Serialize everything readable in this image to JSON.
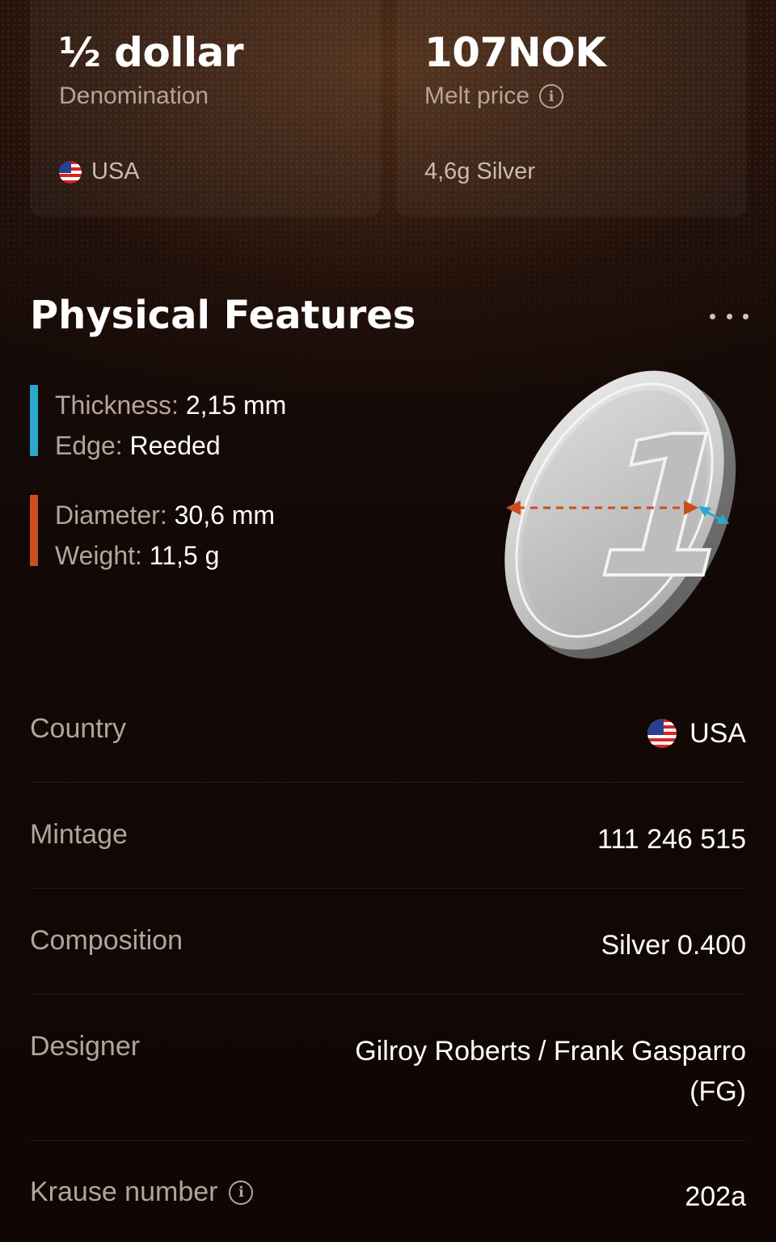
{
  "summary": {
    "denomination_value": "½ dollar",
    "denomination_label": "Denomination",
    "country": "USA",
    "melt_value": "107NOK",
    "melt_label": "Melt price",
    "metal_content": "4,6g Silver"
  },
  "physical": {
    "title": "Physical Features",
    "thickness_label": "Thickness:",
    "thickness_value": "2,15 mm",
    "edge_label": "Edge:",
    "edge_value": "Reeded",
    "diameter_label": "Diameter:",
    "diameter_value": "30,6 mm",
    "weight_label": "Weight:",
    "weight_value": "11,5 g",
    "coin_numeral": "1"
  },
  "details": [
    {
      "label": "Country",
      "value": "USA"
    },
    {
      "label": "Mintage",
      "value": "111 246 515"
    },
    {
      "label": "Composition",
      "value": "Silver 0.400"
    },
    {
      "label": "Designer",
      "value": "Gilroy Roberts / Frank Gasparro (FG)"
    },
    {
      "label": "Krause number",
      "value": "202a"
    }
  ],
  "icons": {
    "info": "info-icon",
    "flag": "us-flag-icon",
    "more": "more-icon"
  },
  "colors": {
    "thickness_accent": "#2aa9cc",
    "diameter_accent": "#c9501c",
    "background": "#140a07"
  }
}
